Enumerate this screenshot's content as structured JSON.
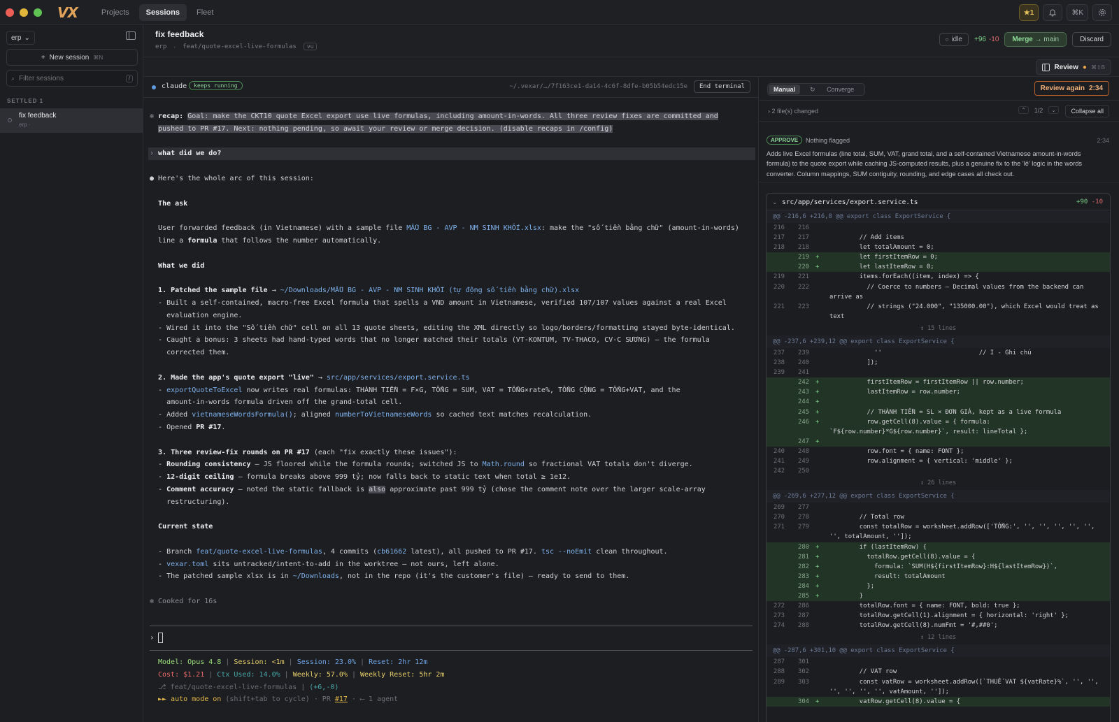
{
  "topbar": {
    "logo": "VX",
    "tabs": [
      {
        "label": "Projects"
      },
      {
        "label": "Sessions",
        "active": true
      },
      {
        "label": "Fleet"
      }
    ],
    "star_count": "★1",
    "icons": [
      "bell-icon",
      "command-icon",
      "gear-icon"
    ],
    "cmd_label": "⌘K"
  },
  "sidebar": {
    "repo": "erp",
    "new_session": "New session",
    "new_session_kbd": "⌘N",
    "filter_placeholder": "Filter sessions",
    "filter_kbd": "/",
    "section": "SETTLED 1",
    "sessions": [
      {
        "title": "fix feedback",
        "repo": "erp ·"
      }
    ]
  },
  "session": {
    "title": "fix feedback",
    "repo": "erp",
    "branch": "feat/quote-excel-live-formulas",
    "tag": "vu",
    "status": "idle",
    "additions": "+96",
    "deletions": "-10",
    "merge_label": "Merge",
    "merge_target": "→ main",
    "discard_label": "Discard",
    "review_label": "Review",
    "review_kbd": "⌘⇧B"
  },
  "terminal": {
    "agent": "claude",
    "badge": "keeps running",
    "path": "~/.vexar/…/7f163ce1-da14-4c6f-8dfe-b05b54edc15e",
    "end_label": "End terminal",
    "recap_label": "recap:",
    "recap_1": "Goal: make the CKT10 quote Excel export use live formulas, including amount-in-words. All three review fixes are committed and",
    "recap_2": "pushed to PR #17. Next: nothing pending, so await your review or merge decision. (disable recaps in /config)",
    "user_q": "what did we do?",
    "lines": {
      "intro": "Here's the whole arc of this session:",
      "h_ask": "The ask",
      "ask_1a": "User forwarded feedback (in Vietnamese) with a sample file ",
      "ask_1b": "MẪU BG - AVP - NM SINH KHỐI.xlsx",
      "ask_1c": ": make the \"số tiền bằng chữ\" (amount-in-words)",
      "ask_2a": "line a ",
      "ask_2b": "formula",
      "ask_2c": " that follows the number automatically.",
      "h_did": "What we did",
      "s1_a": "1. Patched the sample file",
      "s1_b": " → ",
      "s1_c": "~/Downloads/MẪU BG - AVP - NM SINH KHỐI (tự động số tiền bằng chữ).xlsx",
      "s1_l1": "- Built a self-contained, macro-free Excel formula that spells a VND amount in Vietnamese, verified 107/107 values against a real Excel",
      "s1_l2": "  evaluation engine.",
      "s1_l3": "- Wired it into the \"Số tiền chữ\" cell on all 13 quote sheets, editing the XML directly so logo/borders/formatting stayed byte-identical.",
      "s1_l4": "- Caught a bonus: 3 sheets had hand-typed words that no longer matched their totals (VT-KONTUM, TV-THACO, CV-C SƯƠNG) — the formula",
      "s1_l5": "  corrected them.",
      "s2_a": "2. Made the app's quote export \"live\"",
      "s2_b": " → ",
      "s2_c": "src/app/services/export.service.ts",
      "s2_l1a": "- ",
      "s2_l1b": "exportQuoteToExcel",
      "s2_l1c": " now writes real formulas: THÀNH TIỀN = F×G, TỔNG = SUM, VAT = TỔNG×rate%, TỔNG CỘNG = TỔNG+VAT, and the",
      "s2_l2": "  amount-in-words formula driven off the grand-total cell.",
      "s2_l3a": "- Added ",
      "s2_l3b": "vietnameseWordsFormula()",
      "s2_l3c": "; aligned ",
      "s2_l3d": "numberToVietnameseWords",
      "s2_l3e": " so cached text matches recalculation.",
      "s2_l4a": "- Opened ",
      "s2_l4b": "PR #17",
      "s2_l4c": ".",
      "s3_a": "3. Three review-fix rounds on PR #17",
      "s3_b": " (each \"fix exactly these issues\"):",
      "s3_l1a": "- ",
      "s3_l1b": "Rounding consistency",
      "s3_l1c": " — JS floored while the formula rounds; switched JS to ",
      "s3_l1d": "Math.round",
      "s3_l1e": " so fractional VAT totals don't diverge.",
      "s3_l2a": "- ",
      "s3_l2b": "12-digit ceiling",
      "s3_l2c": " — formula breaks above 999 tỷ; now falls back to static text when total ≥ 1e12.",
      "s3_l3a": "- ",
      "s3_l3b": "Comment accuracy",
      "s3_l3c": " — noted the static fallback is ",
      "s3_l3d": "also",
      "s3_l3e": " approximate past 999 tỷ (chose the comment note over the larger scale-array",
      "s3_l4": "  restructuring).",
      "h_state": "Current state",
      "cs_l1a": "- Branch ",
      "cs_l1b": "feat/quote-excel-live-formulas",
      "cs_l1c": ", 4 commits (",
      "cs_l1d": "cb61662",
      "cs_l1e": " latest), all pushed to PR #17. ",
      "cs_l1f": "tsc --noEmit",
      "cs_l1g": " clean throughout.",
      "cs_l2a": "- ",
      "cs_l2b": "vexar.toml",
      "cs_l2c": " sits untracked/intent-to-add in the worktree — not ours, left alone.",
      "cs_l3a": "- The patched sample xlsx is in ",
      "cs_l3b": "~/Downloads",
      "cs_l3c": ", not in the repo (it's the customer's file) — ready to send to them.",
      "cooked": "✻ Cooked for 16s"
    },
    "prompt_char": "›",
    "status": {
      "model_label": "Model: ",
      "model": "Opus 4.8",
      "session_label": "Session: ",
      "session": "<1m",
      "session_pct_label": "Session: ",
      "session_pct": "23.0%",
      "reset_label": "Reset: ",
      "reset": "2hr 12m",
      "cost_label": "Cost: ",
      "cost": "$1.21",
      "ctx_label": "Ctx Used: ",
      "ctx": "14.0%",
      "weekly_label": "Weekly: ",
      "weekly": "57.0%",
      "weekly_reset_label": "Weekly Reset: ",
      "weekly_reset": "5hr 2m",
      "branch": "⎇ feat/quote-excel-live-formulas",
      "branch_diff": "(+6,-0)",
      "mode_a": "►► auto mode on",
      "mode_b": " (shift+tab to cycle) · PR ",
      "mode_pr": "#17",
      "mode_c": " · ⟵ 1 agent"
    }
  },
  "review": {
    "mode_manual": "Manual",
    "mode_converge": "Converge",
    "review_again": "Review again",
    "review_timer": "2:34",
    "files_changed": "2 file(s) changed",
    "pager": "1/2",
    "collapse_all": "Collapse all",
    "verdict": "APPROVE",
    "verdict_note": "Nothing flagged",
    "verdict_time": "2:34",
    "verdict_text": "Adds live Excel formulas (line total, SUM, VAT, grand total, and a self-contained Vietnamese amount-in-words formula) to the quote export while caching JS-computed results, plus a genuine fix to the 'lẻ' logic in the words converter. Column mappings, SUM contiguity, rounding, and edge cases all check out.",
    "file": "src/app/services/export.service.ts",
    "file_add": "+90",
    "file_del": "-10",
    "hunks": [
      {
        "header": "@@ -216,6 +216,8 @@ export class ExportService {",
        "lines": [
          {
            "o": "216",
            "n": "216",
            "t": "ctx",
            "c": ""
          },
          {
            "o": "217",
            "n": "217",
            "t": "ctx",
            "c": "        // Add items"
          },
          {
            "o": "218",
            "n": "218",
            "t": "ctx",
            "c": "        let totalAmount = 0;"
          },
          {
            "o": "",
            "n": "219",
            "t": "add",
            "c": "        let firstItemRow = 0;"
          },
          {
            "o": "",
            "n": "220",
            "t": "add",
            "c": "        let lastItemRow = 0;"
          },
          {
            "o": "219",
            "n": "221",
            "t": "ctx",
            "c": "        items.forEach((item, index) => {"
          },
          {
            "o": "220",
            "n": "222",
            "t": "ctx",
            "c": "          // Coerce to numbers — Decimal values from the backend can arrive as"
          },
          {
            "o": "221",
            "n": "223",
            "t": "ctx",
            "c": "          // strings (\"24.000\", \"135000.00\"), which Excel would treat as text"
          }
        ],
        "fold": "↕ 15 lines"
      },
      {
        "header": "@@ -237,6 +239,12 @@ export class ExportService {",
        "lines": [
          {
            "o": "237",
            "n": "239",
            "t": "ctx",
            "c": "            ''                          // I - Ghi chú"
          },
          {
            "o": "238",
            "n": "240",
            "t": "ctx",
            "c": "          ]);"
          },
          {
            "o": "239",
            "n": "241",
            "t": "ctx",
            "c": ""
          },
          {
            "o": "",
            "n": "242",
            "t": "add",
            "c": "          firstItemRow = firstItemRow || row.number;"
          },
          {
            "o": "",
            "n": "243",
            "t": "add",
            "c": "          lastItemRow = row.number;"
          },
          {
            "o": "",
            "n": "244",
            "t": "add",
            "c": ""
          },
          {
            "o": "",
            "n": "245",
            "t": "add",
            "c": "          // THÀNH TIỀN = SL × ĐƠN GIÁ, kept as a live formula"
          },
          {
            "o": "",
            "n": "246",
            "t": "add",
            "c": "          row.getCell(8).value = { formula: `F${row.number}*G${row.number}`, result: lineTotal };"
          },
          {
            "o": "",
            "n": "247",
            "t": "add",
            "c": ""
          },
          {
            "o": "240",
            "n": "248",
            "t": "ctx",
            "c": "          row.font = { name: FONT };"
          },
          {
            "o": "241",
            "n": "249",
            "t": "ctx",
            "c": "          row.alignment = { vertical: 'middle' };"
          },
          {
            "o": "242",
            "n": "250",
            "t": "ctx",
            "c": ""
          }
        ],
        "fold": "↕ 26 lines"
      },
      {
        "header": "@@ -269,6 +277,12 @@ export class ExportService {",
        "lines": [
          {
            "o": "269",
            "n": "277",
            "t": "ctx",
            "c": ""
          },
          {
            "o": "270",
            "n": "278",
            "t": "ctx",
            "c": "        // Total row"
          },
          {
            "o": "271",
            "n": "279",
            "t": "ctx",
            "c": "        const totalRow = worksheet.addRow(['TỔNG:', '', '', '', '', '', '', totalAmount, '']);"
          },
          {
            "o": "",
            "n": "280",
            "t": "add",
            "c": "        if (lastItemRow) {"
          },
          {
            "o": "",
            "n": "281",
            "t": "add",
            "c": "          totalRow.getCell(8).value = {"
          },
          {
            "o": "",
            "n": "282",
            "t": "add",
            "c": "            formula: `SUM(H${firstItemRow}:H${lastItemRow})`,"
          },
          {
            "o": "",
            "n": "283",
            "t": "add",
            "c": "            result: totalAmount"
          },
          {
            "o": "",
            "n": "284",
            "t": "add",
            "c": "          };"
          },
          {
            "o": "",
            "n": "285",
            "t": "add",
            "c": "        }"
          },
          {
            "o": "272",
            "n": "286",
            "t": "ctx",
            "c": "        totalRow.font = { name: FONT, bold: true };"
          },
          {
            "o": "273",
            "n": "287",
            "t": "ctx",
            "c": "        totalRow.getCell(1).alignment = { horizontal: 'right' };"
          },
          {
            "o": "274",
            "n": "288",
            "t": "ctx",
            "c": "        totalRow.getCell(8).numFmt = '#,##0';"
          }
        ],
        "fold": "↕ 12 lines"
      },
      {
        "header": "@@ -287,6 +301,10 @@ export class ExportService {",
        "lines": [
          {
            "o": "287",
            "n": "301",
            "t": "ctx",
            "c": ""
          },
          {
            "o": "288",
            "n": "302",
            "t": "ctx",
            "c": "        // VAT row"
          },
          {
            "o": "289",
            "n": "303",
            "t": "ctx",
            "c": "        const vatRow = worksheet.addRow([`THUẾ VAT ${vatRate}%`, '', '', '', '', '', '', vatAmount, '']);"
          },
          {
            "o": "",
            "n": "304",
            "t": "add",
            "c": "        vatRow.getCell(8).value = {"
          }
        ],
        "fold": ""
      }
    ]
  },
  "colors": {
    "accent": "#e0a35a",
    "link": "#7fb2ec",
    "add_bg": "#223426",
    "merge": "#8fdb99"
  }
}
